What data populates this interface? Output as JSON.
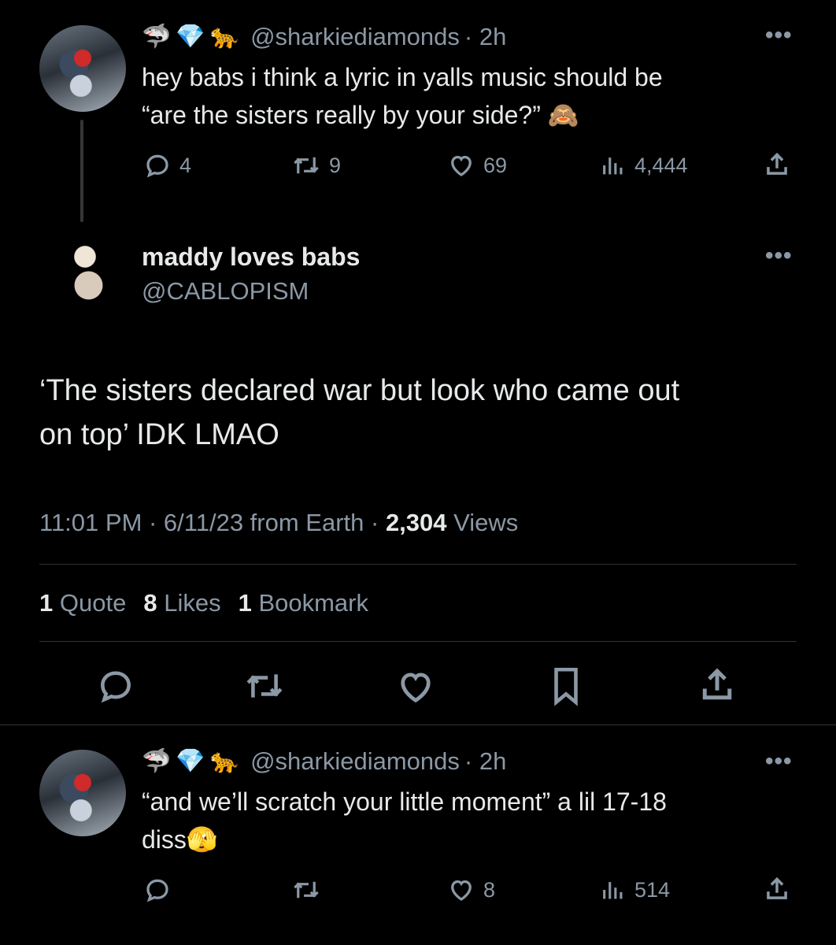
{
  "reply1": {
    "handle": "@sharkiediamonds",
    "time": "· 2h",
    "text_line1": "hey babs i think a lyric in yalls music should be",
    "text_line2": "“are the sisters really by your side?”",
    "text_emoji": "🙈",
    "badges": [
      "🦈",
      "💎",
      "🐆"
    ],
    "replies": "4",
    "reposts": "9",
    "likes": "69",
    "views": "4,444"
  },
  "main_tweet": {
    "display_name": "maddy loves babs",
    "handle": "@CABLOPISM",
    "text_line1": "‘The sisters declared war but look who came out",
    "text_line2": "on top’ IDK LMAO",
    "time": "11:01 PM · 6/11/23 from Earth · ",
    "views_count": "2,304",
    "views_label": " Views",
    "quotes_count": "1",
    "quotes_label": "Quote",
    "likes_count": "8",
    "likes_label": "Likes",
    "bookmarks_count": "1",
    "bookmarks_label": "Bookmark"
  },
  "reply2": {
    "handle": "@sharkiediamonds",
    "time": "· 2h",
    "text_line1": "“and we’ll scratch your little moment” a lil 17-18",
    "text_line2": "diss",
    "text_emoji": "🫣",
    "badges": [
      "🦈",
      "💎",
      "🐆"
    ],
    "likes": "8",
    "views": "514"
  },
  "more_glyph": "•••",
  "colors": {
    "background": "#000000",
    "text": "#e7e9ea",
    "muted": "#8b98a5",
    "divider": "#2f3336"
  }
}
